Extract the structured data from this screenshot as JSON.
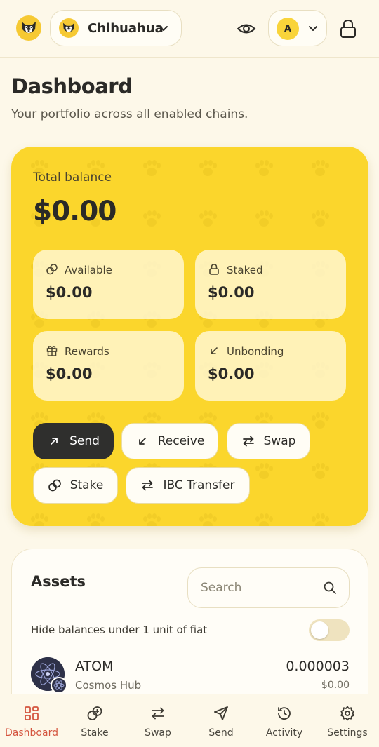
{
  "header": {
    "wallet_name": "Chihuahua",
    "account_initial": "A"
  },
  "page": {
    "title": "Dashboard",
    "subtitle": "Your portfolio across all enabled chains."
  },
  "balance": {
    "label": "Total balance",
    "value": "$0.00",
    "stats": [
      {
        "label": "Available",
        "value": "$0.00",
        "icon": "coins-icon"
      },
      {
        "label": "Staked",
        "value": "$0.00",
        "icon": "lock-icon"
      },
      {
        "label": "Rewards",
        "value": "$0.00",
        "icon": "gift-icon"
      },
      {
        "label": "Unbonding",
        "value": "$0.00",
        "icon": "arrow-down-left-icon"
      }
    ],
    "actions": [
      {
        "label": "Send",
        "icon": "arrow-up-right-icon"
      },
      {
        "label": "Receive",
        "icon": "arrow-down-left-icon"
      },
      {
        "label": "Swap",
        "icon": "swap-icon"
      },
      {
        "label": "Stake",
        "icon": "coins-icon"
      },
      {
        "label": "IBC Transfer",
        "icon": "transfer-icon"
      }
    ]
  },
  "assets": {
    "title": "Assets",
    "search_placeholder": "Search",
    "hide_small_label": "Hide balances under 1 unit of fiat",
    "hide_small_enabled": false,
    "items": [
      {
        "symbol": "ATOM",
        "chain": "Cosmos Hub",
        "amount": "0.000003",
        "fiat": "$0.00"
      }
    ]
  },
  "nav": {
    "items": [
      {
        "label": "Dashboard",
        "icon": "grid-icon",
        "active": true
      },
      {
        "label": "Stake",
        "icon": "coins-icon",
        "active": false
      },
      {
        "label": "Swap",
        "icon": "swap-icon",
        "active": false
      },
      {
        "label": "Send",
        "icon": "send-icon",
        "active": false
      },
      {
        "label": "Activity",
        "icon": "history-icon",
        "active": false
      },
      {
        "label": "Settings",
        "icon": "gear-icon",
        "active": false
      }
    ]
  },
  "colors": {
    "accent": "#fbd62c",
    "background": "#fdf8e9",
    "active_nav": "#d4553f",
    "dark_button": "#2f2f2d"
  }
}
